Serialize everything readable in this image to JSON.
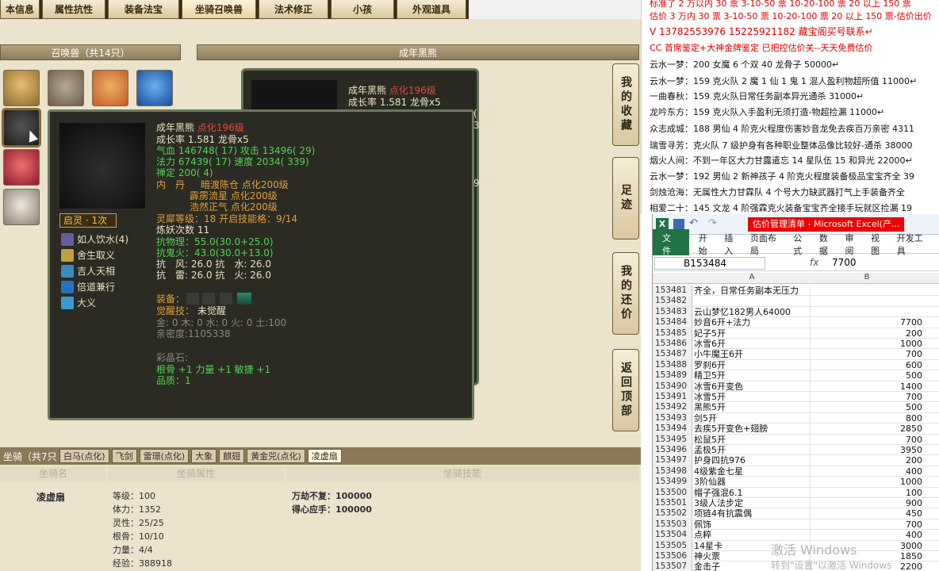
{
  "game": {
    "tabs": [
      "本信息",
      "属性抗性",
      "装备法宝",
      "坐骑召唤兽",
      "法术修正",
      "小孩",
      "外观道具"
    ],
    "summon_header": "召唤兽（共14只）",
    "detail_header": "成年黑熊",
    "side_buttons": [
      "我的收藏",
      "足迹",
      "我的还价",
      "返回顶部"
    ],
    "bg_panel": {
      "name": "成年黑熊",
      "point": "点化196级",
      "growth": "成长率 1.581 龙骨x5",
      "v1": "( 29)",
      "v2": "339)",
      "v3": "9/14"
    },
    "tooltip": {
      "name": "成年黑熊",
      "point": "点化196级",
      "growth": "成长率 1.581 龙骨x5",
      "hp": "气血 146748( 17) 攻击 13496( 29)",
      "mp": "法力 67439( 17) 速度 2034( 339)",
      "zen": "禅定 200( 4)",
      "neidan_label": "内　丹",
      "neidan": [
        "暗渡陈仓 点化200级",
        "霹雳流星 点化200级",
        "浩然正气 点化200级"
      ],
      "soul": "灵犀等级：18 开启技能格：9/14",
      "refine": "炼妖次数 11",
      "res1": "抗物理：55.0(30.0+25.0)",
      "res2": "抗鬼火：43.0(30.0+13.0)",
      "res3": "抗　风: 26.0 抗　水: 26.0",
      "res4": "抗　雷: 26.0 抗　火: 26.0",
      "equip_label": "装备：",
      "awaken_label": "觉醒技：",
      "awaken_value": "未觉醒",
      "elements": "金: 0 木: 0 水: 0 火: 0 土:100",
      "intimacy": "亲密度:1105338",
      "gem_label": "彩晶石:",
      "gem1": "根骨 +1 力量 +1 敏捷 +1",
      "gem2": "品质：1",
      "qiling": "启灵 · 1次",
      "skills": [
        "如人饮水(4)",
        "舍生取义",
        "吉人天相",
        "倍道兼行",
        "大义"
      ]
    },
    "mount_tabs": [
      "坐骑（共7只",
      "白马(点化)",
      "飞剑",
      "雷璟(点化)",
      "大象",
      "麒翅",
      "黄金兕(点化)",
      "凌虚扇"
    ],
    "mount_cols": [
      "坐骑名",
      "坐骑属性",
      "坐骑技能"
    ],
    "mount_name": "凌虚扇",
    "mount_stats": [
      "等级：100",
      "体力：1352",
      "灵性：25/25",
      "根骨：10/10",
      "力量：4/4",
      "经验：388918"
    ],
    "mount_skills": [
      "万劫不复：100000",
      "得心应手：100000"
    ]
  },
  "right_text": {
    "lines": [
      {
        "t": "标准了 2 万以内 30 票 3-10-50 票 10-20-100 票 20 以上 150 票",
        "red": true
      },
      {
        "t": "估价 3 万内 30 票  3-10-50 票 10-20-100 票 20 以上 150 票-估价出价",
        "red": true
      },
      {
        "t": "V 13782553976    15225921182   藏宝阁买号联系↵",
        "red": true
      },
      {
        "t": "CC 首席鉴定+大神金牌鉴定   已把控估价关--天天免费估价",
        "red": true
      },
      {
        "t": "云水一梦：200 女魔 6 个双 40 龙骨子 50000↵",
        "red": false
      },
      {
        "t": "云水一梦：159 克火队 2 魔 1 仙 1 鬼 1 混人盈利物超所值 11000↵",
        "red": false
      },
      {
        "t": "一曲春秋：159 克火队日常任务副本异光通杀 31000↵",
        "red": false
      },
      {
        "t": "龙吟东方：159 克火队入手盈利无须打造-物超捡漏 11000↵",
        "red": false
      },
      {
        "t": "众志成城：188 男仙 4 阶克火程度伤害妙音龙免去疾百万亲密 4311",
        "red": false
      },
      {
        "t": "瑞雪寻芳：克火队 7 级护身有各种职业整体品像比较好-通杀 38000",
        "red": false
      },
      {
        "t": "烟火人间：不到一年区大力甘露遣忘 14 星队伍 15 和异光 22000↵",
        "red": false
      },
      {
        "t": "云水一梦：192 男仙 2 新神孩子 4 阶克火程度装备极品宝宝齐全 39",
        "red": false
      },
      {
        "t": "剑烛沧海：无属性大力甘霖队 4 个号大力缺武器打气上手装备齐全",
        "red": false
      },
      {
        "t": "相爱二十：145 文龙 4 阶强霖克火装备宝宝齐全接手玩就区捡漏 19",
        "red": false
      }
    ]
  },
  "excel": {
    "title": "估价管理清单 - Microsoft Excel(产...",
    "ribbon": [
      "文件",
      "开始",
      "插入",
      "页面布局",
      "公式",
      "数据",
      "审阅",
      "视图",
      "开发工具"
    ],
    "namebox": "B153484",
    "fx": "fx",
    "formula": "7700",
    "col_a": "A",
    "col_b": "B",
    "rows": [
      {
        "n": "153481",
        "a": "齐全，日常任务副本无压力",
        "b": ""
      },
      {
        "n": "153482",
        "a": "",
        "b": ""
      },
      {
        "n": "153483",
        "a": "云山梦忆182男人64000",
        "b": ""
      },
      {
        "n": "153484",
        "a": "妙音6开+法力",
        "b": "7700"
      },
      {
        "n": "153485",
        "a": "妃子5开",
        "b": "200"
      },
      {
        "n": "153486",
        "a": "冰雪6开",
        "b": "1000"
      },
      {
        "n": "153487",
        "a": "小牛魔王6开",
        "b": "700"
      },
      {
        "n": "153488",
        "a": "罗刹6开",
        "b": "600"
      },
      {
        "n": "153489",
        "a": "精卫5开",
        "b": "500"
      },
      {
        "n": "153490",
        "a": "冰雪6开变色",
        "b": "1400"
      },
      {
        "n": "153491",
        "a": "冰雪5开",
        "b": "700"
      },
      {
        "n": "153492",
        "a": "黑熊5开",
        "b": "500"
      },
      {
        "n": "153493",
        "a": "剑5开",
        "b": "800"
      },
      {
        "n": "153494",
        "a": "去疾5开变色+翅膀",
        "b": "2850"
      },
      {
        "n": "153495",
        "a": "松鼠5开",
        "b": "700"
      },
      {
        "n": "153496",
        "a": "孟极5开",
        "b": "3950"
      },
      {
        "n": "153497",
        "a": "护身四抗976",
        "b": "200"
      },
      {
        "n": "153498",
        "a": "4级紫金七星",
        "b": "400"
      },
      {
        "n": "153499",
        "a": "3阶仙器",
        "b": "1000"
      },
      {
        "n": "153500",
        "a": "帽子强混6.1",
        "b": "100"
      },
      {
        "n": "153501",
        "a": "3级人法步定",
        "b": "900"
      },
      {
        "n": "153502",
        "a": "项链4有抗震偶",
        "b": "450"
      },
      {
        "n": "153503",
        "a": "佩饰",
        "b": "700"
      },
      {
        "n": "153504",
        "a": "点粹",
        "b": "400"
      },
      {
        "n": "153505",
        "a": "14星卡",
        "b": "3000"
      },
      {
        "n": "153506",
        "a": "神火票",
        "b": "1850"
      },
      {
        "n": "153507",
        "a": "金击子",
        "b": "2200"
      }
    ],
    "watermark1": "激活 Windows",
    "watermark2": "转到\"设置\"以激活 Windows"
  },
  "colors": {
    "accent_red": "#e24a3a",
    "stat_green": "#4fd64f",
    "excel_green": "#217346"
  }
}
